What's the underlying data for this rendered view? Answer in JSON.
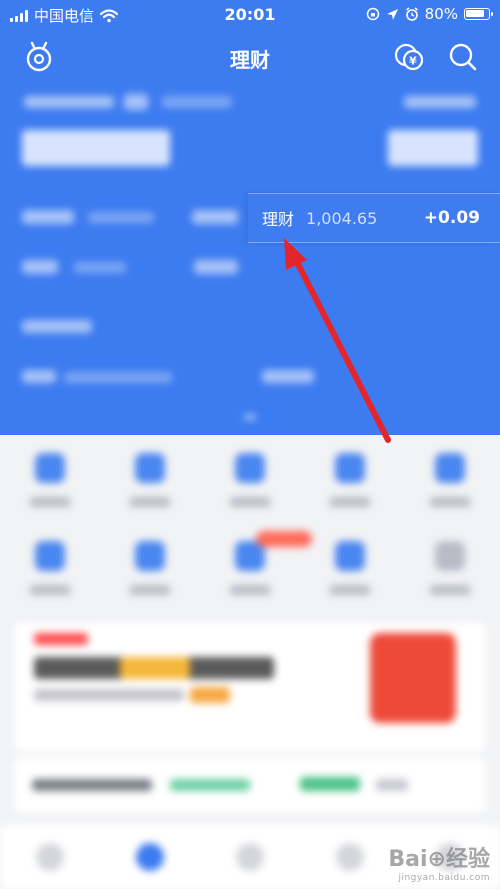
{
  "status_bar": {
    "carrier": "中国电信",
    "time": "20:01",
    "battery": "80%"
  },
  "navbar": {
    "title": "理财",
    "left_icon": "piggy-bank-icon",
    "coin_icon": "yuan-coin-icon",
    "search_icon": "search-icon"
  },
  "tooltip": {
    "label": "理财",
    "value": "1,004.65",
    "change": "+0.09"
  },
  "watermark": {
    "brand": "Bai⊕经验",
    "url": "jingyan.baidu.com"
  },
  "colors": {
    "header_blue": "#3d7bf0",
    "arrow_red": "#e3262b",
    "background": "#f2f3f5"
  }
}
